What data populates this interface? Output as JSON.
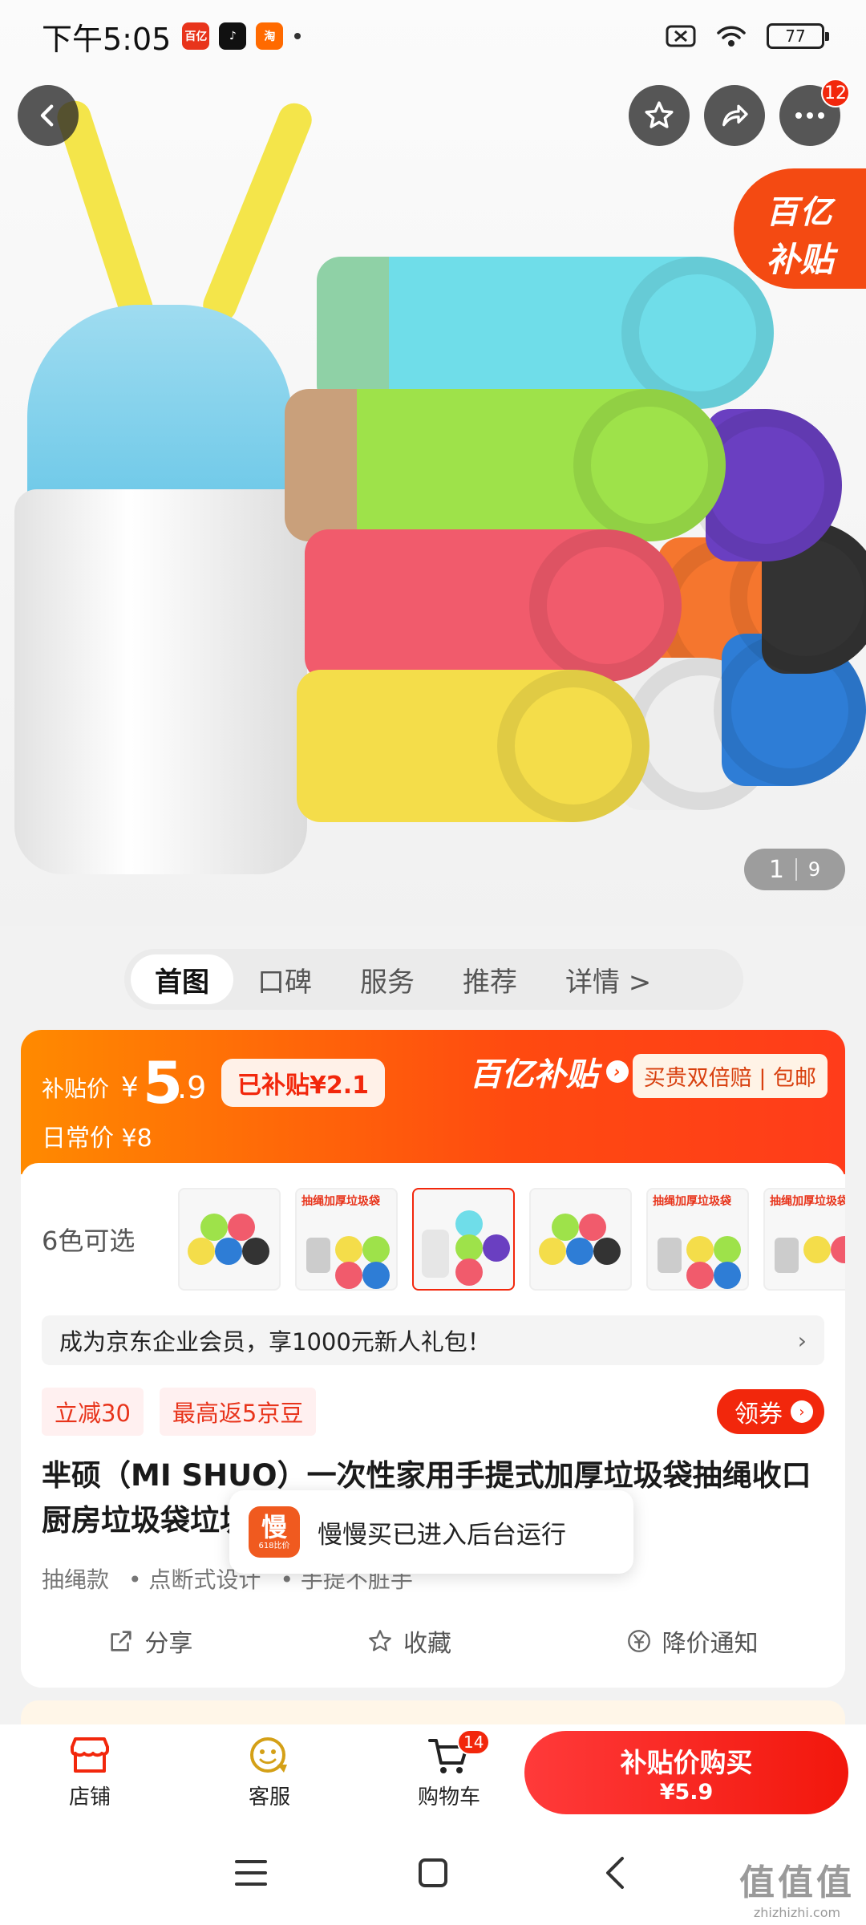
{
  "status_bar": {
    "time": "下午5:05",
    "apps": [
      {
        "icon": "jd-icon",
        "color": "#e8341b",
        "text": "百亿"
      },
      {
        "icon": "tiktok-icon",
        "color": "#111111",
        "text": "♪"
      },
      {
        "icon": "taobao-icon",
        "color": "#ff6a00",
        "text": "淘"
      }
    ],
    "battery": "77"
  },
  "hero": {
    "cart_count": "12",
    "subsidy_tag_line1": "百亿",
    "subsidy_tag_line2": "补贴",
    "page_current": "1",
    "page_total": "9"
  },
  "tabs": [
    "首图",
    "口碑",
    "服务",
    "推荐",
    "详情 >"
  ],
  "price": {
    "label": "补贴价",
    "yen": "¥",
    "integer": "5",
    "decimal": ".9",
    "saved": "已补贴¥2.1",
    "regular": "日常价 ¥8",
    "brand": "百亿补贴",
    "tagline": "买贵双倍赔 | 包邮"
  },
  "variants": {
    "label": "6色可选",
    "thumb_text": "抽绳加厚垃圾袋"
  },
  "member_bar": "成为京东企业会员，享1000元新人礼包！",
  "member_arrow": "›",
  "promos": [
    "立减30",
    "最高返5京豆"
  ],
  "coupon_label": "领券",
  "product_title": "芈硕（MI SHUO）一次性家用手提式加厚垃圾袋抽绳收口厨房垃圾袋垃圾袋塑料袋 5卷颜色随机",
  "attributes": [
    "抽绳款",
    "• 点断式设计",
    "• 手提不脏手"
  ],
  "actions": [
    {
      "label": "分享",
      "icon": "share-icon"
    },
    {
      "label": "收藏",
      "icon": "star-outline-icon"
    },
    {
      "label": "降价通知",
      "icon": "price-drop-icon"
    }
  ],
  "toast": {
    "app_icon_main": "慢",
    "app_icon_sub": "618比价",
    "text": "慢慢买已进入后台运行"
  },
  "bottom_bar": {
    "shop": "店铺",
    "service": "客服",
    "cart": "购物车",
    "cart_count": "14",
    "buy_line1": "补贴价购买",
    "buy_line2": "¥5.9"
  },
  "watermark": {
    "big": "值值值",
    "small": "zhizhizhi.com"
  },
  "colors": {
    "accent": "#f2270c",
    "orange": "#ff6a00"
  }
}
